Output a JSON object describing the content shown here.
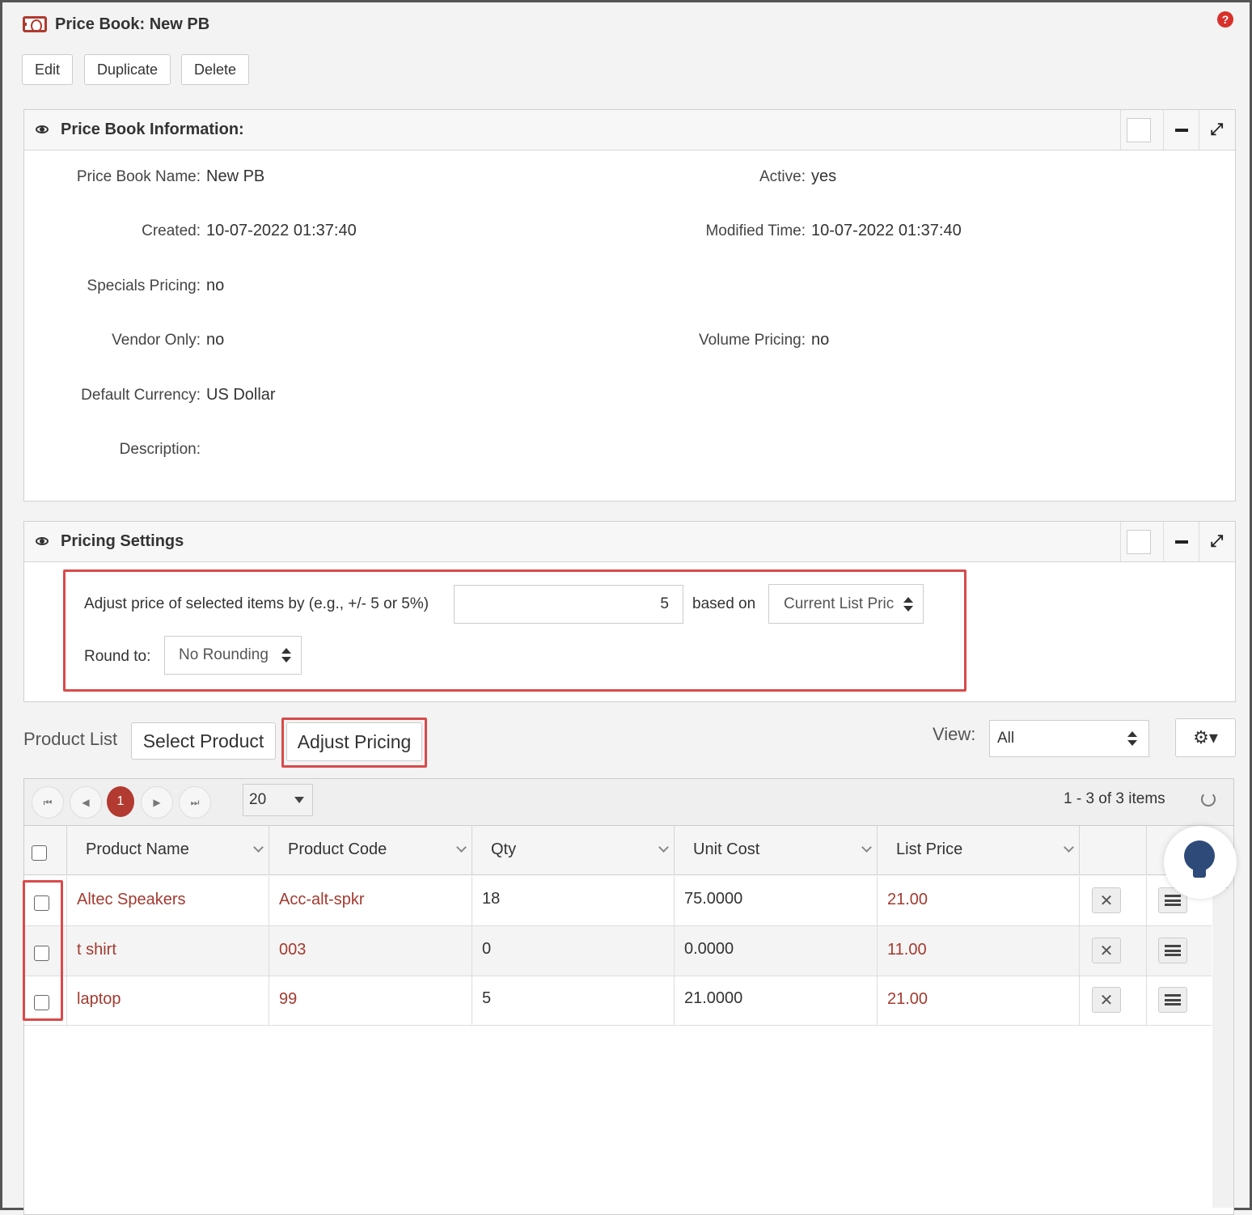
{
  "header": {
    "title": "Price Book: New PB",
    "icon": "price-book-icon",
    "help_icon": "help-icon",
    "help_glyph": "?"
  },
  "toolbar": {
    "edit_label": "Edit",
    "duplicate_label": "Duplicate",
    "delete_label": "Delete"
  },
  "info_panel": {
    "title": "Price Book Information:",
    "fields": {
      "name_label": "Price Book Name:",
      "name_value": "New PB",
      "active_label": "Active:",
      "active_value": "yes",
      "created_label": "Created:",
      "created_value": "10-07-2022 01:37:40",
      "modified_label": "Modified Time:",
      "modified_value": "10-07-2022 01:37:40",
      "specials_label": "Specials Pricing:",
      "specials_value": "no",
      "vendor_label": "Vendor Only:",
      "vendor_value": "no",
      "volume_label": "Volume Pricing:",
      "volume_value": "no",
      "currency_label": "Default Currency:",
      "currency_value": "US Dollar",
      "description_label": "Description:",
      "description_value": ""
    }
  },
  "pricing_panel": {
    "title": "Pricing Settings",
    "adjust_label": "Adjust price of selected items by (e.g., +/- 5 or 5%)",
    "adjust_value": "5",
    "based_on_label": "based on",
    "based_on_value": "Current List Pric",
    "round_label": "Round to:",
    "round_value": "No Rounding"
  },
  "product_list": {
    "label": "Product List",
    "select_product_label": "Select Product",
    "adjust_pricing_label": "Adjust Pricing",
    "view_label": "View:",
    "view_value": "All",
    "settings_icon": "gear-icon",
    "settings_glyph": "⚙▾"
  },
  "pager": {
    "first_glyph": "⏮",
    "prev_glyph": "◀",
    "current_page": "1",
    "next_glyph": "▶",
    "last_glyph": "⏭",
    "page_size": "20",
    "info": "1 - 3 of 3 items"
  },
  "table": {
    "columns": [
      "Product Name",
      "Product Code",
      "Qty",
      "Unit Cost",
      "List Price"
    ],
    "rows": [
      {
        "name": "Altec Speakers",
        "code": "Acc-alt-spkr",
        "qty": "18",
        "unit_cost": "75.0000",
        "list_price": "21.00"
      },
      {
        "name": "t shirt",
        "code": "003",
        "qty": "0",
        "unit_cost": "0.0000",
        "list_price": "11.00"
      },
      {
        "name": "laptop",
        "code": "99",
        "qty": "5",
        "unit_cost": "21.0000",
        "list_price": "21.00"
      }
    ],
    "delete_glyph": "✕"
  },
  "colors": {
    "accent_red": "#b23a30",
    "highlight_box": "#d94a4a",
    "link": "#a33a2f"
  }
}
